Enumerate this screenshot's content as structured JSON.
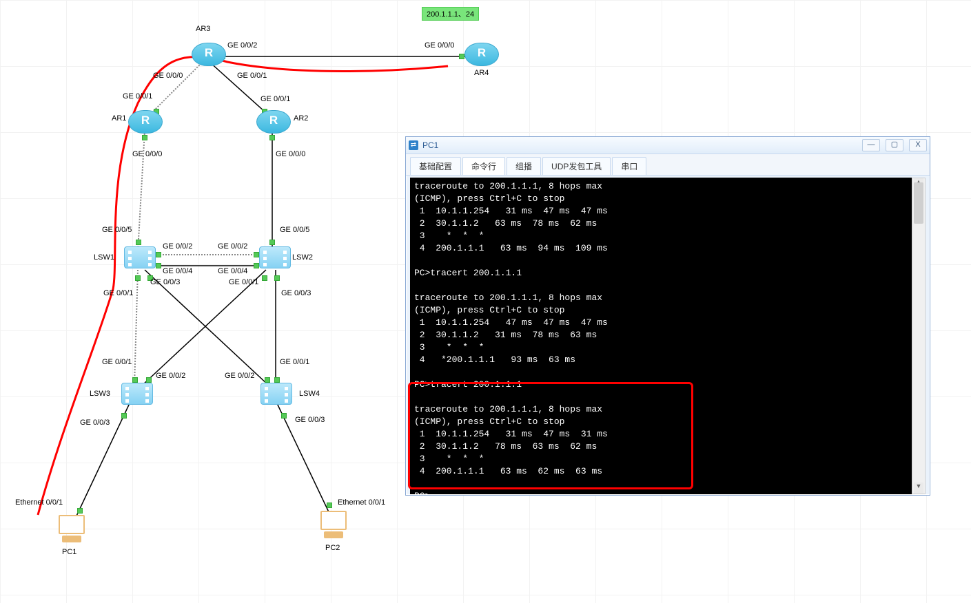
{
  "badge": "200.1.1.1、24",
  "devices": {
    "ar1": "AR1",
    "ar2": "AR2",
    "ar3": "AR3",
    "ar4": "AR4",
    "lsw1": "LSW1",
    "lsw2": "LSW2",
    "lsw3": "LSW3",
    "lsw4": "LSW4",
    "pc1": "PC1",
    "pc2": "PC2"
  },
  "ports": {
    "ar3_ge002": "GE 0/0/2",
    "ar4_ge000": "GE 0/0/0",
    "ar3_ge000": "GE 0/0/0",
    "ar3_ge001": "GE 0/0/1",
    "ar1_ge001": "GE 0/0/1",
    "ar2_ge001": "GE 0/0/1",
    "ar1_ge000": "GE 0/0/0",
    "ar2_ge000": "GE 0/0/0",
    "lsw1_ge005": "GE 0/0/5",
    "lsw2_ge005": "GE 0/0/5",
    "lsw1_ge002_t": "GE 0/0/2",
    "lsw2_ge002_t": "GE 0/0/2",
    "lsw1_ge004": "GE 0/0/4",
    "lsw2_ge004": "GE 0/0/4",
    "lsw1_ge003": "GE 0/0/3",
    "lsw2_ge001": "GE 0/0/1",
    "lsw1_ge001": "GE 0/0/1",
    "lsw2_ge003": "GE 0/0/3",
    "lsw3_ge001_t": "GE 0/0/1",
    "lsw4_ge001_t": "GE 0/0/1",
    "lsw3_ge002": "GE 0/0/2",
    "lsw4_ge002": "GE 0/0/2",
    "lsw3_ge003": "GE 0/0/3",
    "lsw4_ge003": "GE 0/0/3",
    "pc1_e001": "Ethernet 0/0/1",
    "pc2_e001": "Ethernet 0/0/1"
  },
  "window": {
    "title": "PC1",
    "tabs": [
      "基础配置",
      "命令行",
      "组播",
      "UDP发包工具",
      "串口"
    ],
    "active_tab": 1,
    "minimize": "—",
    "maximize": "▢",
    "close": "X"
  },
  "terminal_lines": [
    "traceroute to 200.1.1.1, 8 hops max",
    "(ICMP), press Ctrl+C to stop",
    " 1  10.1.1.254   31 ms  47 ms  47 ms",
    " 2  30.1.1.2   63 ms  78 ms  62 ms",
    " 3    *  *  *",
    " 4  200.1.1.1   63 ms  94 ms  109 ms",
    "",
    "PC>tracert 200.1.1.1",
    "",
    "traceroute to 200.1.1.1, 8 hops max",
    "(ICMP), press Ctrl+C to stop",
    " 1  10.1.1.254   47 ms  47 ms  47 ms",
    " 2  30.1.1.2   31 ms  78 ms  63 ms",
    " 3    *  *  *",
    " 4   *200.1.1.1   93 ms  63 ms",
    "",
    "PC>tracert 200.1.1.1",
    "",
    "traceroute to 200.1.1.1, 8 hops max",
    "(ICMP), press Ctrl+C to stop",
    " 1  10.1.1.254   31 ms  47 ms  31 ms",
    " 2  30.1.1.2   78 ms  63 ms  62 ms",
    " 3    *  *  *",
    " 4  200.1.1.1   63 ms  62 ms  63 ms",
    "",
    "PC>"
  ]
}
